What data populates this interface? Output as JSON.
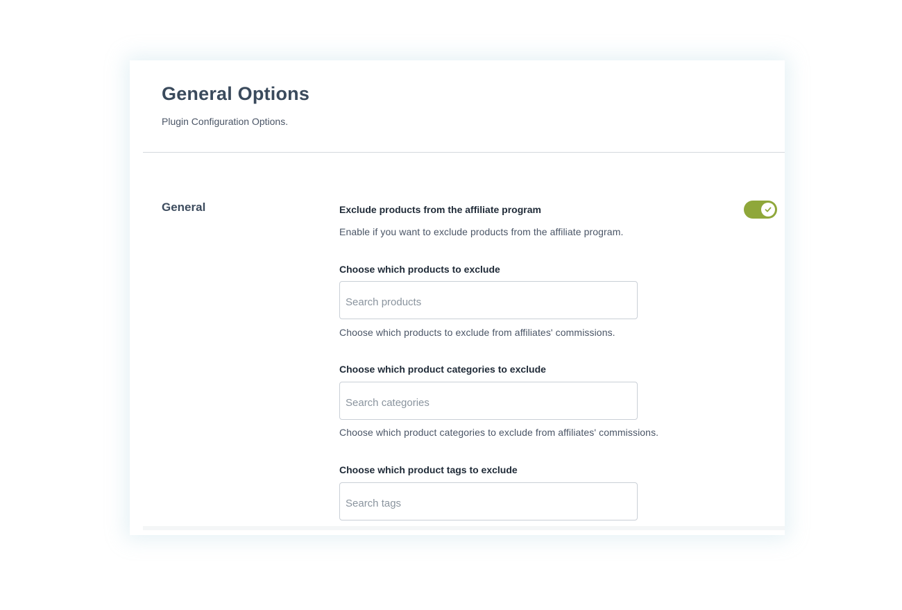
{
  "header": {
    "title": "General Options",
    "subtitle": "Plugin Configuration Options."
  },
  "section": {
    "title": "General"
  },
  "exclude_toggle": {
    "label": "Exclude products from the affiliate program",
    "description": "Enable if you want to exclude products from the affiliate program.",
    "enabled": true,
    "accent_color": "#8fa73a",
    "knob_icon": "check-icon"
  },
  "products_field": {
    "label": "Choose which products to exclude",
    "placeholder": "Search products",
    "value": "",
    "description": "Choose which products to exclude from affiliates' commissions."
  },
  "categories_field": {
    "label": "Choose which product categories to exclude",
    "placeholder": "Search categories",
    "value": "",
    "description": "Choose which product categories to exclude from affiliates' commissions."
  },
  "tags_field": {
    "label": "Choose which product tags to exclude",
    "placeholder": "Search tags",
    "value": ""
  }
}
